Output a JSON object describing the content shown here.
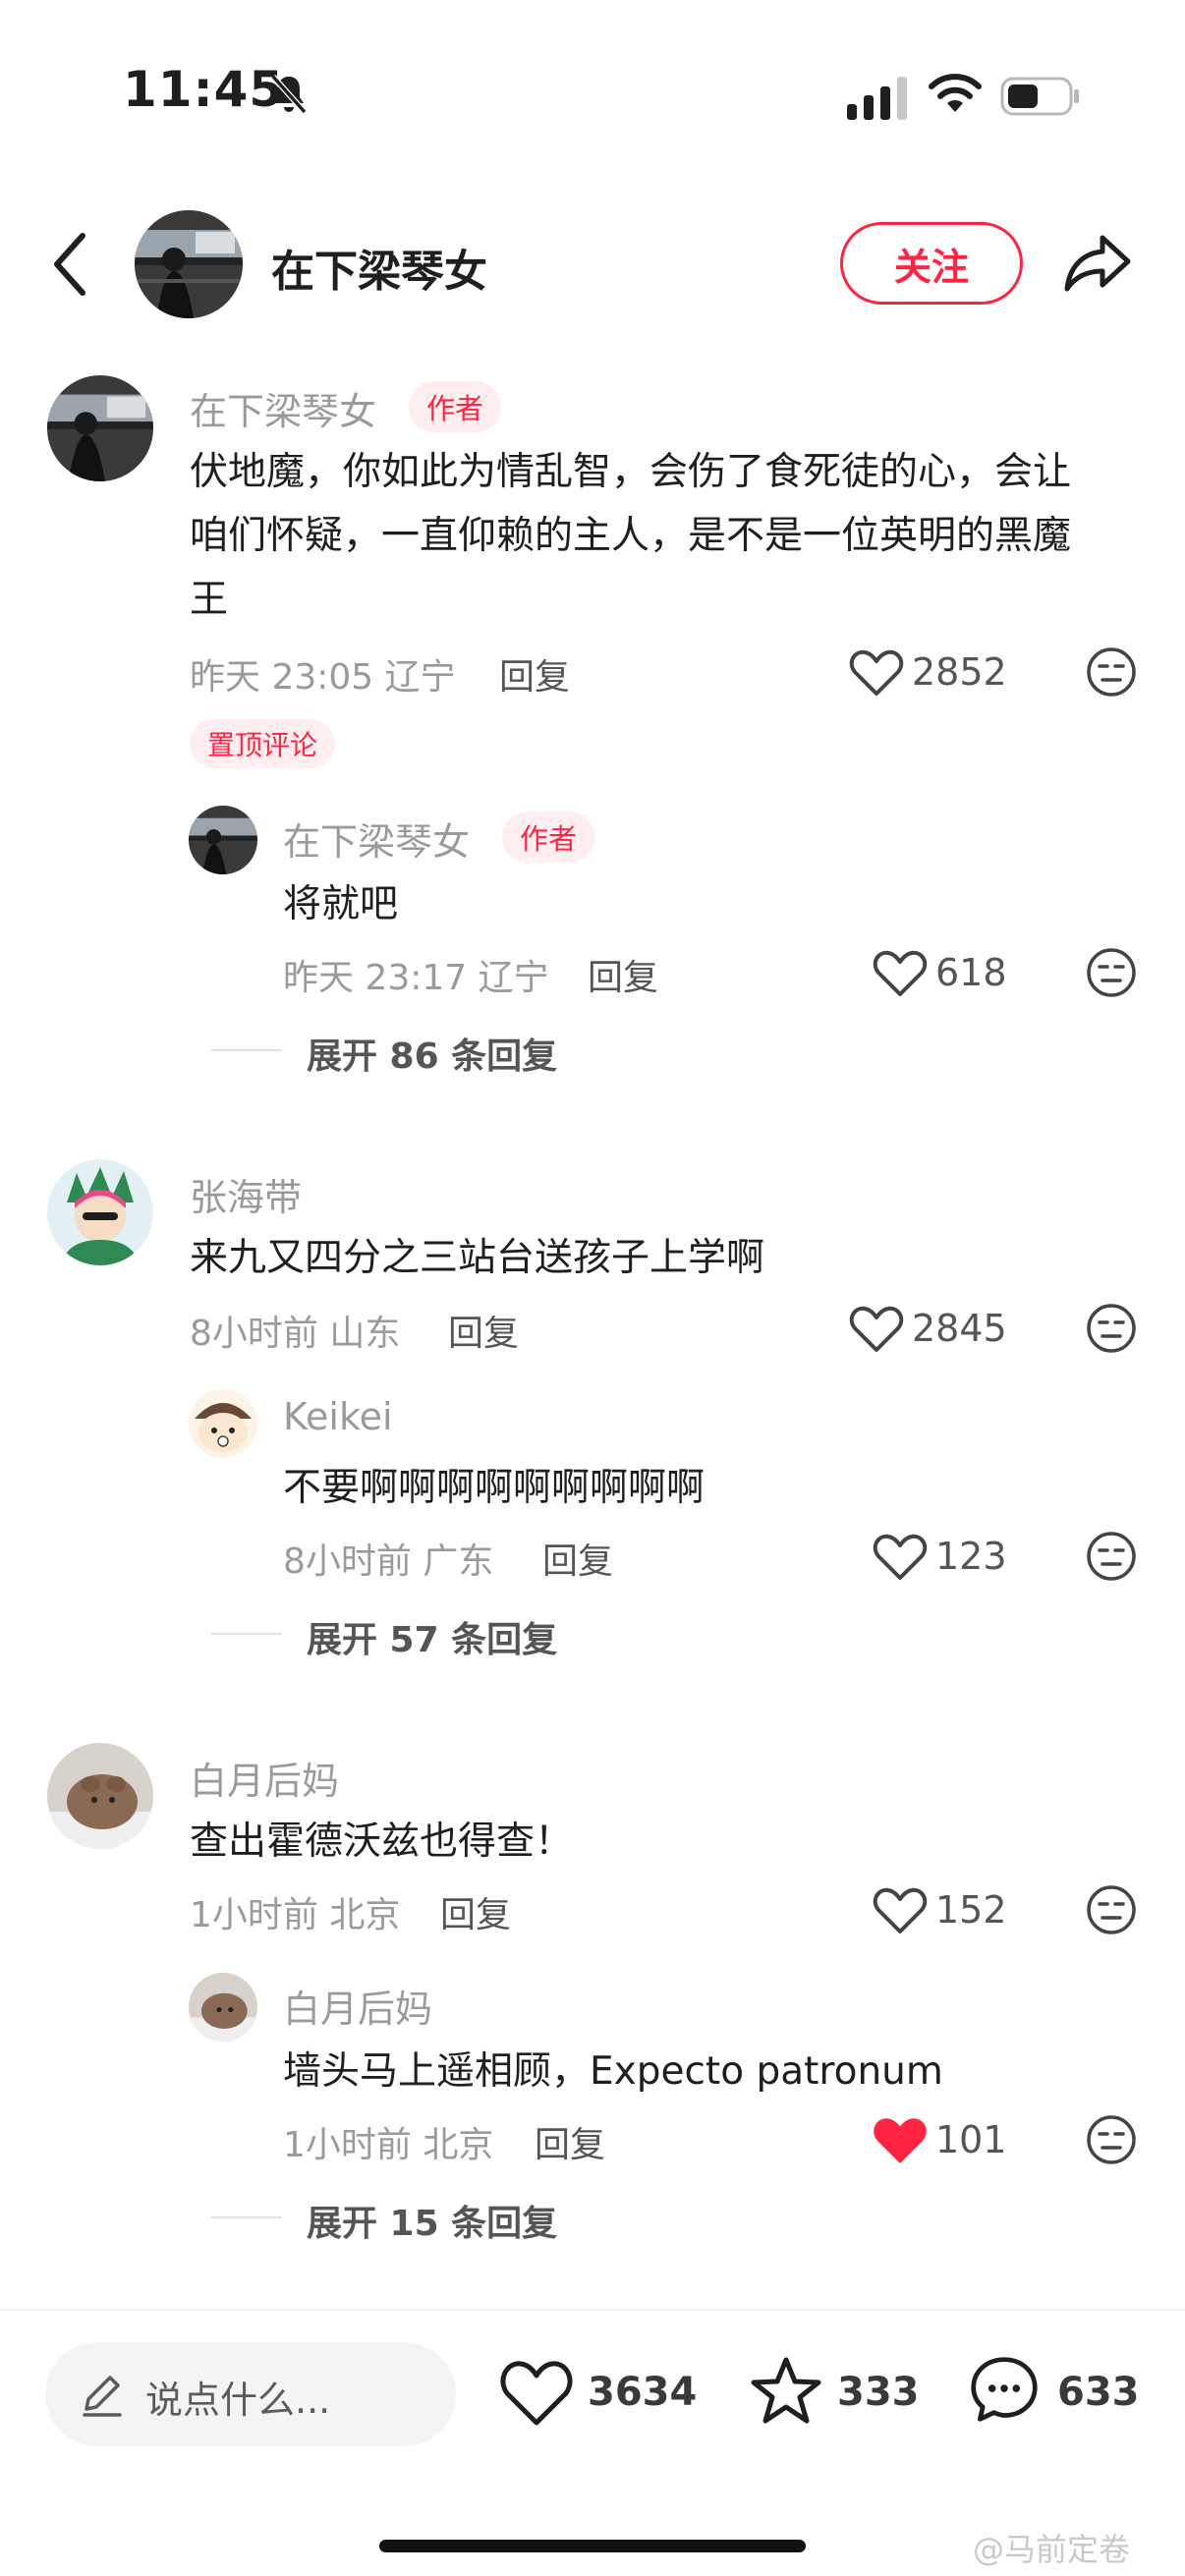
{
  "status_bar": {
    "time": "11:45"
  },
  "header": {
    "username": "在下梁琴女",
    "follow_label": "关注"
  },
  "comments": [
    {
      "username": "在下梁琴女",
      "tag": "作者",
      "lines": [
        "伏地魔，你如此为情乱智，会伤了食死徒的心，会让",
        "咱们怀疑，一直仰赖的主人，是不是一位英明的黑魔",
        "王"
      ],
      "meta": "昨天 23:05 辽宁",
      "reply_label": "回复",
      "likes": "2852",
      "pinned_label": "置顶评论",
      "reply": {
        "username": "在下梁琴女",
        "tag": "作者",
        "text": "将就吧",
        "meta": "昨天 23:17 辽宁",
        "reply_label": "回复",
        "likes": "618"
      },
      "expand_label": "展开 86 条回复"
    },
    {
      "username": "张海带",
      "text": "来九又四分之三站台送孩子上学啊",
      "meta": "8小时前 山东",
      "reply_label": "回复",
      "likes": "2845",
      "reply": {
        "username": "Keikei",
        "text": "不要啊啊啊啊啊啊啊啊啊",
        "meta": "8小时前 广东",
        "reply_label": "回复",
        "likes": "123"
      },
      "expand_label": "展开 57 条回复"
    },
    {
      "username": "白月后妈",
      "text": "查出霍德沃兹也得查！",
      "meta": "1小时前 北京",
      "reply_label": "回复",
      "likes": "152",
      "reply": {
        "username": "白月后妈",
        "text": "墙头马上遥相顾，Expecto patronum",
        "meta": "1小时前 北京",
        "reply_label": "回复",
        "likes": "101",
        "liked": true
      },
      "expand_label": "展开 15 条回复"
    }
  ],
  "bottom_bar": {
    "input_placeholder": "说点什么...",
    "likes": "3634",
    "favorites": "333",
    "comments": "633"
  },
  "watermark": "@马前定卷",
  "colors": {
    "accent": "#ff2442",
    "liked": "#ff2442",
    "muted_text": "#9a9a9a"
  }
}
